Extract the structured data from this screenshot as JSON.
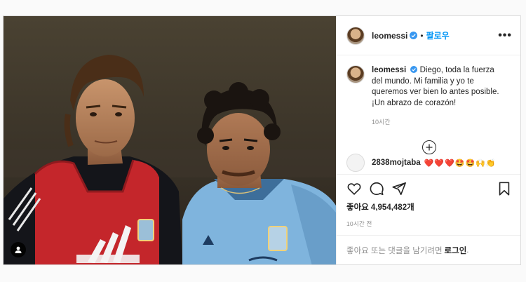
{
  "post": {
    "username": "leomessi",
    "follow_label": "팔로우",
    "dot": "•",
    "more_label": "•••",
    "caption": {
      "username": "leomessi",
      "text": "Diego, toda la fuerza del mundo. Mi familia y yo te queremos ver bien lo antes posible. ¡Un abrazo de corazón!",
      "time": "10시간"
    },
    "comment": {
      "username": "2838mojtaba",
      "emojis": "❤️❤️❤️🤩🤩🙌👏"
    },
    "likes_label": "좋아요 4,954,482개",
    "posted_time": "10시간 전",
    "login_prompt": {
      "text": "좋아요 또는 댓글을 남기려면",
      "link": "로그인",
      "suffix": "."
    }
  },
  "icons": {
    "verified": "verified-icon",
    "load_more": "plus-circle-icon",
    "like": "heart-icon",
    "comment": "comment-icon",
    "share": "share-icon",
    "save": "bookmark-icon",
    "tag": "user-tag-icon"
  },
  "colors": {
    "link": "#0095f6",
    "verified": "#3897f0",
    "border": "#dbdbdb",
    "muted": "#8e8e8e"
  }
}
